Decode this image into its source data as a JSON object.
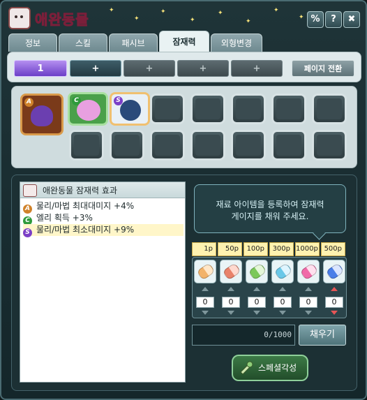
{
  "window": {
    "title": "애완동물",
    "buttons": [
      "%",
      "?",
      "✖"
    ]
  },
  "tabs": [
    {
      "label": "정보",
      "active": false
    },
    {
      "label": "스킬",
      "active": false
    },
    {
      "label": "패시브",
      "active": false
    },
    {
      "label": "잠재력",
      "active": true
    },
    {
      "label": "외형변경",
      "active": false
    }
  ],
  "page_bar": {
    "pages": [
      {
        "label": "1",
        "state": "active"
      },
      {
        "label": "+",
        "state": "enabled"
      },
      {
        "label": "+",
        "state": "disabled"
      },
      {
        "label": "+",
        "state": "disabled"
      },
      {
        "label": "+",
        "state": "disabled"
      }
    ],
    "switch_label": "페이지 전환"
  },
  "pet_slots": {
    "filled": [
      {
        "grade": "A",
        "grade_color": "#d0822a"
      },
      {
        "grade": "C",
        "grade_color": "#2f9a3b"
      },
      {
        "grade": "S",
        "grade_color": "#7b3fc7"
      }
    ],
    "empty_top_count": 5,
    "empty_bottom_count": 7
  },
  "effects": {
    "title": "애완동물 잠재력 효과",
    "rows": [
      {
        "grade": "A",
        "grade_color": "#d0822a",
        "text": "물리/마법 최대대미지 +4%",
        "highlight": false
      },
      {
        "grade": "C",
        "grade_color": "#2f9a3b",
        "text": "엘리 획득 +3%",
        "highlight": false
      },
      {
        "grade": "S",
        "grade_color": "#7b3fc7",
        "text": "물리/마법 최소대미지 +9%",
        "highlight": true
      }
    ]
  },
  "hint": {
    "line1": "재료 아이템을 등록하여 잠재력",
    "line2": "게이지를 채워 주세요."
  },
  "materials": [
    {
      "price": "1p",
      "qty": "0",
      "color": "#f2b36a",
      "color2": "#ffe7c8"
    },
    {
      "price": "50p",
      "qty": "0",
      "color": "#e8826a",
      "color2": "#ffd9cf"
    },
    {
      "price": "100p",
      "qty": "0",
      "color": "#7cc85a",
      "color2": "#e4f7d8"
    },
    {
      "price": "300p",
      "qty": "0",
      "color": "#6ac8e8",
      "color2": "#dff5ff"
    },
    {
      "price": "1000p",
      "qty": "0",
      "color": "#f06aa8",
      "color2": "#ffe0ee"
    },
    {
      "price": "500p",
      "qty": "0",
      "color": "#4a7ee8",
      "color2": "#dbe6ff"
    }
  ],
  "gauge": {
    "text": "0/1000",
    "value": 0,
    "max": 1000
  },
  "fill_button": "채우기",
  "special_button": "스페셜각성"
}
